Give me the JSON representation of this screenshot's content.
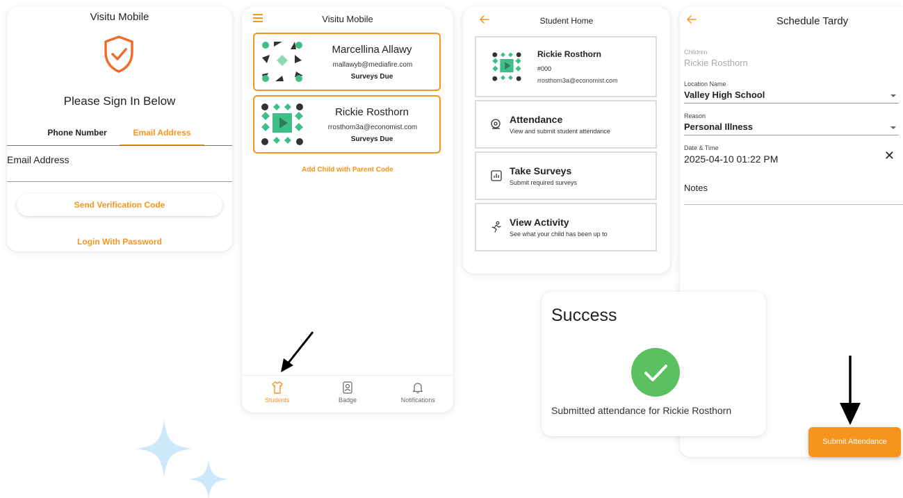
{
  "colors": {
    "accent": "#f7941d",
    "success": "#5bc05f",
    "sparkle": "#cde8fb"
  },
  "login": {
    "title": "Visitu Mobile",
    "heading": "Please Sign In Below",
    "tabs": [
      "Phone Number",
      "Email Address"
    ],
    "active_tab": "Email Address",
    "email_label": "Email Address",
    "send_button": "Send Verification Code",
    "login_link": "Login With Password"
  },
  "students": {
    "title": "Visitu Mobile",
    "children": [
      {
        "name": "Marcellina Allawy",
        "email": "mallawyb@mediafire.com",
        "status": "Surveys Due"
      },
      {
        "name": "Rickie Rosthorn",
        "email": "rrosthorn3a@economist.com",
        "status": "Surveys Due"
      }
    ],
    "add_child_link": "Add Child with Parent Code",
    "nav": [
      {
        "label": "Students",
        "icon": "shirt-icon",
        "active": true
      },
      {
        "label": "Badge",
        "icon": "badge-icon",
        "active": false
      },
      {
        "label": "Notifications",
        "icon": "bell-icon",
        "active": false
      }
    ]
  },
  "student_home": {
    "title": "Student Home",
    "profile": {
      "name": "Rickie Rosthorn",
      "id": "#000",
      "email": "rrosthorn3a@economist.com"
    },
    "menu": [
      {
        "title": "Attendance",
        "subtitle": "View and submit student attendance",
        "icon": "attendance-icon"
      },
      {
        "title": "Take Surveys",
        "subtitle": "Submit required surveys",
        "icon": "survey-chart-icon"
      },
      {
        "title": "View Activity",
        "subtitle": "See what your child has been up to",
        "icon": "running-person-icon"
      }
    ]
  },
  "schedule_tardy": {
    "title": "Schedule Tardy",
    "children_label": "Children",
    "children_value": "Rickie Rosthorn",
    "location_label": "Location Name",
    "location_value": "Valley High School",
    "reason_label": "Reason",
    "reason_value": "Personal Illness",
    "datetime_label": "Date & Time",
    "datetime_value": "2025-04-10 01:22 PM",
    "notes_label": "Notes",
    "submit_button": "Submit Attendance"
  },
  "success_dialog": {
    "title": "Success",
    "message": "Submitted attendance for Rickie Rosthorn"
  }
}
